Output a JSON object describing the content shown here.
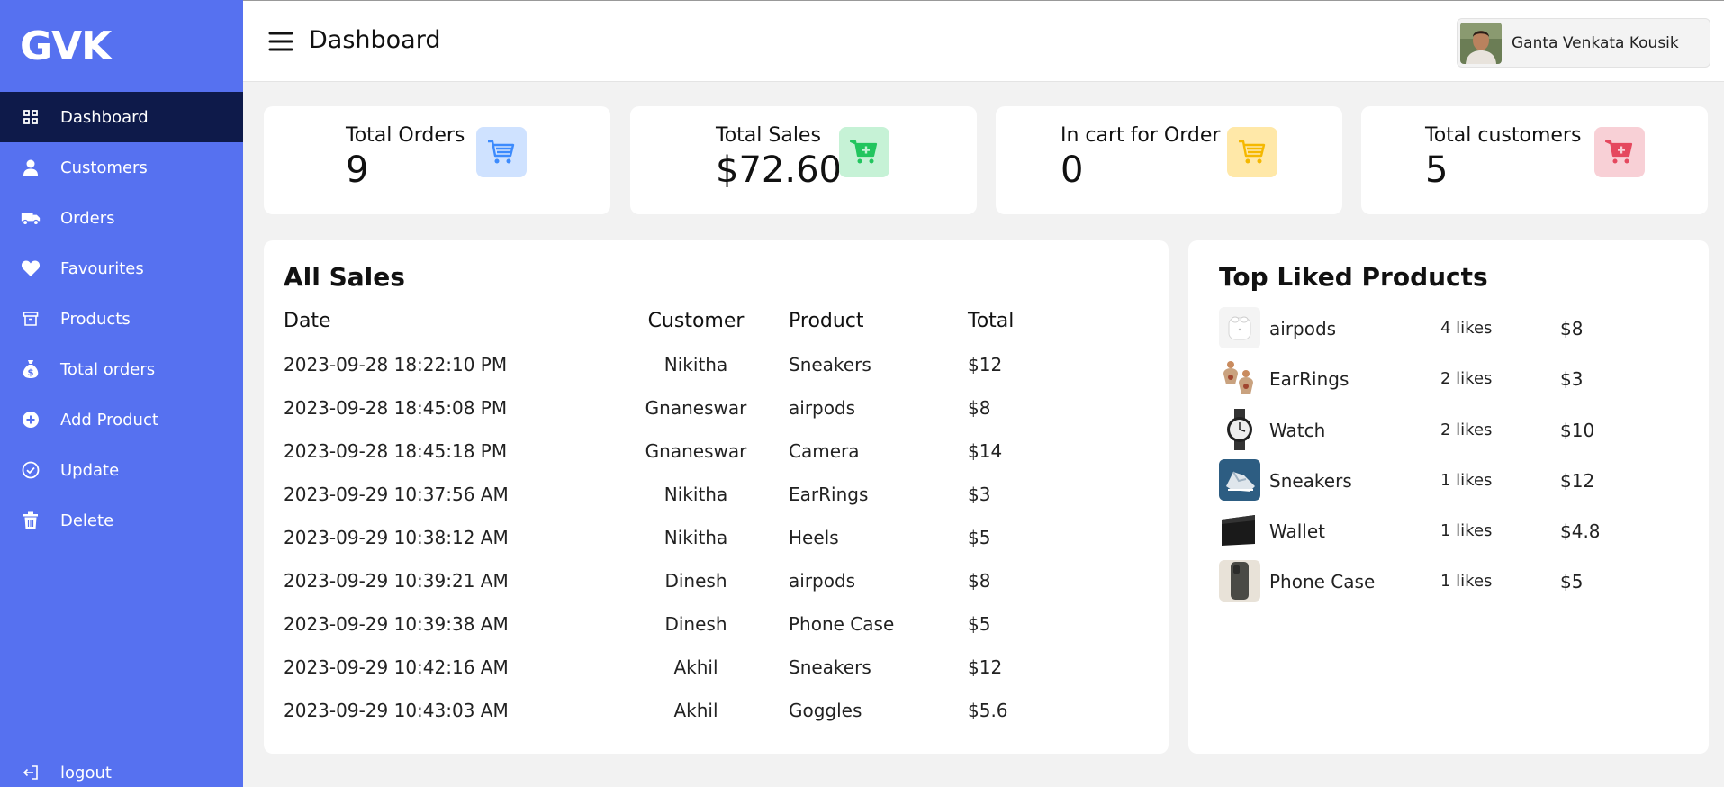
{
  "brand": "GVK",
  "sidebar": {
    "items": [
      {
        "label": "Dashboard",
        "icon": "grid-icon",
        "active": true
      },
      {
        "label": "Customers",
        "icon": "user-icon"
      },
      {
        "label": "Orders",
        "icon": "truck-icon"
      },
      {
        "label": "Favourites",
        "icon": "heart-icon"
      },
      {
        "label": "Products",
        "icon": "archive-box-icon"
      },
      {
        "label": "Total orders",
        "icon": "money-bag-icon"
      },
      {
        "label": "Add Product",
        "icon": "plus-circle-icon"
      },
      {
        "label": "Update",
        "icon": "check-circle-icon"
      },
      {
        "label": "Delete",
        "icon": "trash-icon"
      }
    ],
    "logout_label": "logout"
  },
  "header": {
    "title": "Dashboard",
    "user_name": "Ganta Venkata Kousik"
  },
  "stats": [
    {
      "title": "Total Orders",
      "value": "9",
      "icon": "cart-icon",
      "icon_bg": "#cfe2ff",
      "icon_color": "#3d8bfd"
    },
    {
      "title": "Total Sales",
      "value": "$72.60",
      "icon": "cart-plus-icon",
      "icon_bg": "#c6f2d6",
      "icon_color": "#22c55e"
    },
    {
      "title": "In cart for Order",
      "value": "0",
      "icon": "cart-icon",
      "icon_bg": "#ffe8a8",
      "icon_color": "#f5b800"
    },
    {
      "title": "Total customers",
      "value": "5",
      "icon": "cart-plus-icon",
      "icon_bg": "#f8d0d6",
      "icon_color": "#e5485e"
    }
  ],
  "sales": {
    "title": "All Sales",
    "columns": [
      "Date",
      "Customer",
      "Product",
      "Total"
    ],
    "rows": [
      {
        "date": "2023-09-28 18:22:10 PM",
        "customer": "Nikitha",
        "product": "Sneakers",
        "total": "$12"
      },
      {
        "date": "2023-09-28 18:45:08 PM",
        "customer": "Gnaneswar",
        "product": "airpods",
        "total": "$8"
      },
      {
        "date": "2023-09-28 18:45:18 PM",
        "customer": "Gnaneswar",
        "product": "Camera",
        "total": "$14"
      },
      {
        "date": "2023-09-29 10:37:56 AM",
        "customer": "Nikitha",
        "product": "EarRings",
        "total": "$3"
      },
      {
        "date": "2023-09-29 10:38:12 AM",
        "customer": "Nikitha",
        "product": "Heels",
        "total": "$5"
      },
      {
        "date": "2023-09-29 10:39:21 AM",
        "customer": "Dinesh",
        "product": "airpods",
        "total": "$8"
      },
      {
        "date": "2023-09-29 10:39:38 AM",
        "customer": "Dinesh",
        "product": "Phone Case",
        "total": "$5"
      },
      {
        "date": "2023-09-29 10:42:16 AM",
        "customer": "Akhil",
        "product": "Sneakers",
        "total": "$12"
      },
      {
        "date": "2023-09-29 10:43:03 AM",
        "customer": "Akhil",
        "product": "Goggles",
        "total": "$5.6"
      }
    ]
  },
  "liked": {
    "title": "Top Liked Products",
    "items": [
      {
        "name": "airpods",
        "likes": "4 likes",
        "price": "$8",
        "thumb": "airpods-thumbnail"
      },
      {
        "name": "EarRings",
        "likes": "2 likes",
        "price": "$3",
        "thumb": "earrings-thumbnail"
      },
      {
        "name": "Watch",
        "likes": "2 likes",
        "price": "$10",
        "thumb": "watch-thumbnail"
      },
      {
        "name": "Sneakers",
        "likes": "1 likes",
        "price": "$12",
        "thumb": "sneakers-thumbnail"
      },
      {
        "name": "Wallet",
        "likes": "1 likes",
        "price": "$4.8",
        "thumb": "wallet-thumbnail"
      },
      {
        "name": "Phone Case",
        "likes": "1 likes",
        "price": "$5",
        "thumb": "phone-case-thumbnail"
      }
    ]
  }
}
